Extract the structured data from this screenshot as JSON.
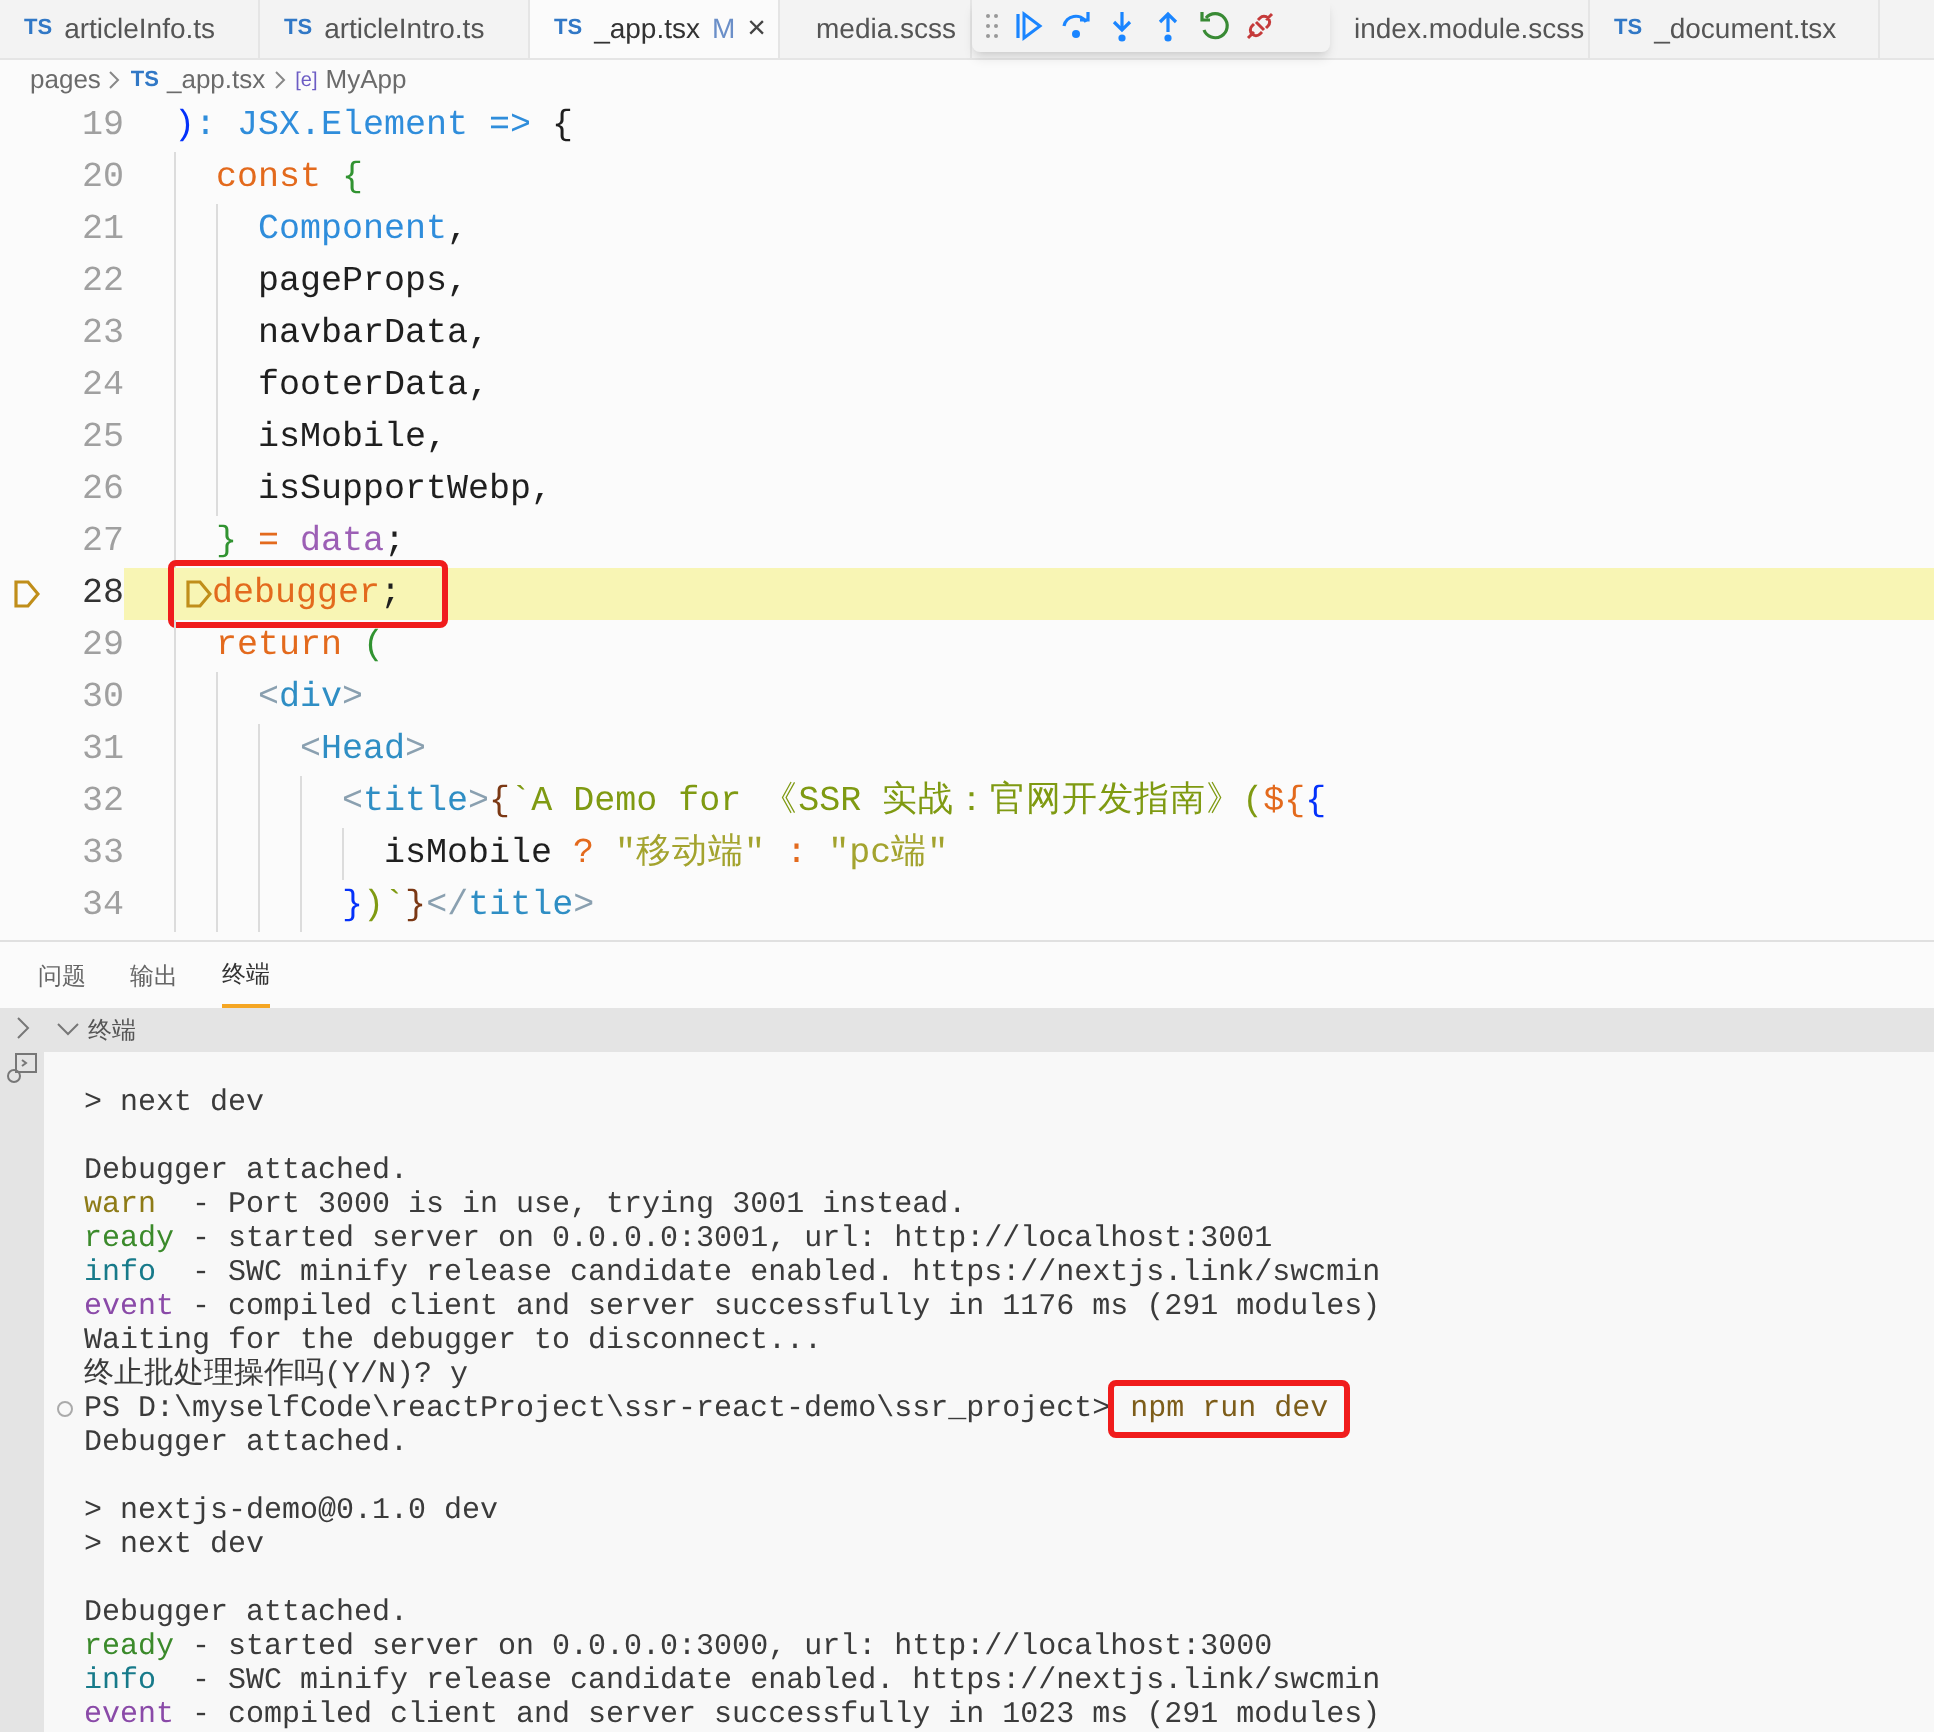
{
  "tabs": [
    {
      "label": "articleInfo.ts",
      "kind": "ts",
      "lang": "TS",
      "selected": false
    },
    {
      "label": "articleIntro.ts",
      "kind": "ts",
      "lang": "TS",
      "selected": false
    },
    {
      "label": "_app.tsx",
      "kind": "ts",
      "lang": "TS",
      "selected": true,
      "badge": "M",
      "close": "×"
    },
    {
      "label": "media.scss",
      "kind": "scss",
      "selected": false
    },
    {
      "label": "index.module.scss",
      "kind": "plain",
      "selected": false
    },
    {
      "label": "_document.tsx",
      "kind": "ts",
      "lang": "TS",
      "selected": false
    }
  ],
  "debug_toolbar": [
    {
      "kind": "continue"
    },
    {
      "kind": "step-over"
    },
    {
      "kind": "step-into"
    },
    {
      "kind": "step-out"
    },
    {
      "kind": "restart"
    },
    {
      "kind": "disconnect"
    }
  ],
  "breadcrumb": [
    {
      "label": "pages",
      "kind": "folder"
    },
    {
      "label": "_app.tsx",
      "kind": "file",
      "lang": "TS"
    },
    {
      "label": "MyApp",
      "kind": "symbol",
      "lang": "[e]"
    }
  ],
  "code_lines": [
    {
      "n": "19",
      "current": false,
      "tokens": [
        {
          "t": ")",
          "kind": "b3"
        },
        {
          "t": ": JSX.Element => ",
          "kind": "var"
        },
        {
          "t": "{",
          "kind": "p"
        }
      ],
      "children": [
        {
          "n": "20",
          "current": false,
          "tokens": [
            {
              "t": "const ",
              "kind": "kw"
            },
            {
              "t": "{",
              "kind": "b1"
            }
          ],
          "children": [
            {
              "n": "21",
              "current": false,
              "tokens": [
                {
                  "t": "Component",
                  "kind": "var"
                },
                {
                  "t": ",",
                  "kind": "p"
                }
              ]
            },
            {
              "n": "22",
              "current": false,
              "tokens": [
                {
                  "t": "pageProps,",
                  "kind": "p"
                }
              ]
            },
            {
              "n": "23",
              "current": false,
              "tokens": [
                {
                  "t": "navbarData,",
                  "kind": "p"
                }
              ]
            },
            {
              "n": "24",
              "current": false,
              "tokens": [
                {
                  "t": "footerData,",
                  "kind": "p"
                }
              ]
            },
            {
              "n": "25",
              "current": false,
              "tokens": [
                {
                  "t": "isMobile,",
                  "kind": "p"
                }
              ]
            },
            {
              "n": "26",
              "current": false,
              "tokens": [
                {
                  "t": "isSupportWebp,",
                  "kind": "p"
                }
              ]
            }
          ]
        },
        {
          "n": "27",
          "current": false,
          "tokens": [
            {
              "t": "}",
              "kind": "b1"
            },
            {
              "t": " = ",
              "kind": "kw"
            },
            {
              "t": "data",
              "kind": "purple"
            },
            {
              "t": ";",
              "kind": "p"
            }
          ]
        },
        {
          "n": "28",
          "current": true,
          "annotated": true,
          "tokens": [
            {
              "t": "debugger",
              "kind": "kw"
            },
            {
              "t": ";",
              "kind": "p"
            }
          ]
        },
        {
          "n": "29",
          "current": false,
          "tokens": [
            {
              "t": "return ",
              "kind": "kw"
            },
            {
              "t": "(",
              "kind": "b1"
            }
          ],
          "children": [
            {
              "n": "30",
              "current": false,
              "tokens": [
                {
                  "t": "<",
                  "kind": "punct"
                },
                {
                  "t": "div",
                  "kind": "tag"
                },
                {
                  "t": ">",
                  "kind": "punct"
                }
              ],
              "children": [
                {
                  "n": "31",
                  "current": false,
                  "tokens": [
                    {
                      "t": "<",
                      "kind": "punct"
                    },
                    {
                      "t": "Head",
                      "kind": "tag"
                    },
                    {
                      "t": ">",
                      "kind": "punct"
                    }
                  ],
                  "children": [
                    {
                      "n": "32",
                      "current": false,
                      "tokens": [
                        {
                          "t": "<",
                          "kind": "punct"
                        },
                        {
                          "t": "title",
                          "kind": "tag"
                        },
                        {
                          "t": ">",
                          "kind": "punct"
                        },
                        {
                          "t": "{",
                          "kind": "b2"
                        },
                        {
                          "t": "`A Demo for 《SSR 实战：官网开发指南》(",
                          "kind": "tpl"
                        },
                        {
                          "t": "${",
                          "kind": "kw"
                        },
                        {
                          "t": "{",
                          "kind": "b3"
                        }
                      ],
                      "children": [
                        {
                          "n": "33",
                          "current": false,
                          "tokens": [
                            {
                              "t": "isMobile",
                              "kind": "p"
                            },
                            {
                              "t": " ? ",
                              "kind": "kw"
                            },
                            {
                              "t": "\"移动端\"",
                              "kind": "str"
                            },
                            {
                              "t": " : ",
                              "kind": "kw"
                            },
                            {
                              "t": "\"pc端\"",
                              "kind": "str"
                            }
                          ]
                        }
                      ]
                    },
                    {
                      "n": "34",
                      "current": false,
                      "tokens": [
                        {
                          "t": "}",
                          "kind": "b3"
                        },
                        {
                          "t": ")",
                          "kind": "tpl"
                        },
                        {
                          "t": "`",
                          "kind": "tpl"
                        },
                        {
                          "t": "}",
                          "kind": "b2"
                        },
                        {
                          "t": "</",
                          "kind": "punct"
                        },
                        {
                          "t": "title",
                          "kind": "tag"
                        },
                        {
                          "t": ">",
                          "kind": "punct"
                        }
                      ]
                    }
                  ]
                }
              ]
            }
          ]
        }
      ]
    }
  ],
  "panel_tabs": [
    {
      "label": "问题",
      "selected": false
    },
    {
      "label": "输出",
      "selected": false
    },
    {
      "label": "终端",
      "selected": true
    }
  ],
  "terminal": {
    "title": "终端",
    "blocks": [
      [
        {
          "kind": "line",
          "tokens": [
            {
              "t": "> next dev",
              "kind": "text"
            }
          ]
        }
      ],
      [
        {
          "kind": "line",
          "tokens": [
            {
              "t": "Debugger attached.",
              "kind": "text"
            }
          ]
        },
        {
          "kind": "line",
          "tokens": [
            {
              "t": "warn",
              "kind": "warn"
            },
            {
              "t": "  - Port 3000 is in use, trying 3001 instead.",
              "kind": "text"
            }
          ]
        },
        {
          "kind": "line",
          "tokens": [
            {
              "t": "ready",
              "kind": "ready"
            },
            {
              "t": " - started server on 0.0.0.0:3001, url: http://localhost:3001",
              "kind": "text"
            }
          ]
        },
        {
          "kind": "line",
          "tokens": [
            {
              "t": "info",
              "kind": "info"
            },
            {
              "t": "  - SWC minify release candidate enabled. https://nextjs.link/swcmin",
              "kind": "text"
            }
          ]
        },
        {
          "kind": "line",
          "tokens": [
            {
              "t": "event",
              "kind": "event"
            },
            {
              "t": " - compiled client and server successfully in 1176 ms (291 modules)",
              "kind": "text"
            }
          ]
        },
        {
          "kind": "line",
          "tokens": [
            {
              "t": "Waiting for the debugger to disconnect...",
              "kind": "text"
            }
          ]
        },
        {
          "kind": "line",
          "tokens": [
            {
              "t": "终止批处理操作吗(Y/N)? y",
              "kind": "text"
            }
          ]
        },
        {
          "kind": "prompt",
          "tokens": [
            {
              "t": "PS D:\\myselfCode\\reactProject\\ssr-react-demo\\ssr_project> ",
              "kind": "text"
            },
            {
              "t": "npm run dev",
              "kind": "npm",
              "annotated": true
            }
          ]
        },
        {
          "kind": "line",
          "tokens": [
            {
              "t": "Debugger attached.",
              "kind": "text"
            }
          ]
        }
      ],
      [
        {
          "kind": "line",
          "tokens": [
            {
              "t": "> nextjs-demo@0.1.0 dev",
              "kind": "text"
            }
          ]
        },
        {
          "kind": "line",
          "tokens": [
            {
              "t": "> next dev",
              "kind": "text"
            }
          ]
        }
      ],
      [
        {
          "kind": "line",
          "tokens": [
            {
              "t": "Debugger attached.",
              "kind": "text"
            }
          ]
        },
        {
          "kind": "line",
          "tokens": [
            {
              "t": "ready",
              "kind": "ready"
            },
            {
              "t": " - started server on 0.0.0.0:3000, url: http://localhost:3000",
              "kind": "text"
            }
          ]
        },
        {
          "kind": "line",
          "tokens": [
            {
              "t": "info",
              "kind": "info"
            },
            {
              "t": "  - SWC minify release candidate enabled. https://nextjs.link/swcmin",
              "kind": "text"
            }
          ]
        },
        {
          "kind": "line",
          "tokens": [
            {
              "t": "event",
              "kind": "event"
            },
            {
              "t": " - compiled client and server successfully in 1023 ms (291 modules)",
              "kind": "text"
            }
          ]
        }
      ]
    ]
  }
}
